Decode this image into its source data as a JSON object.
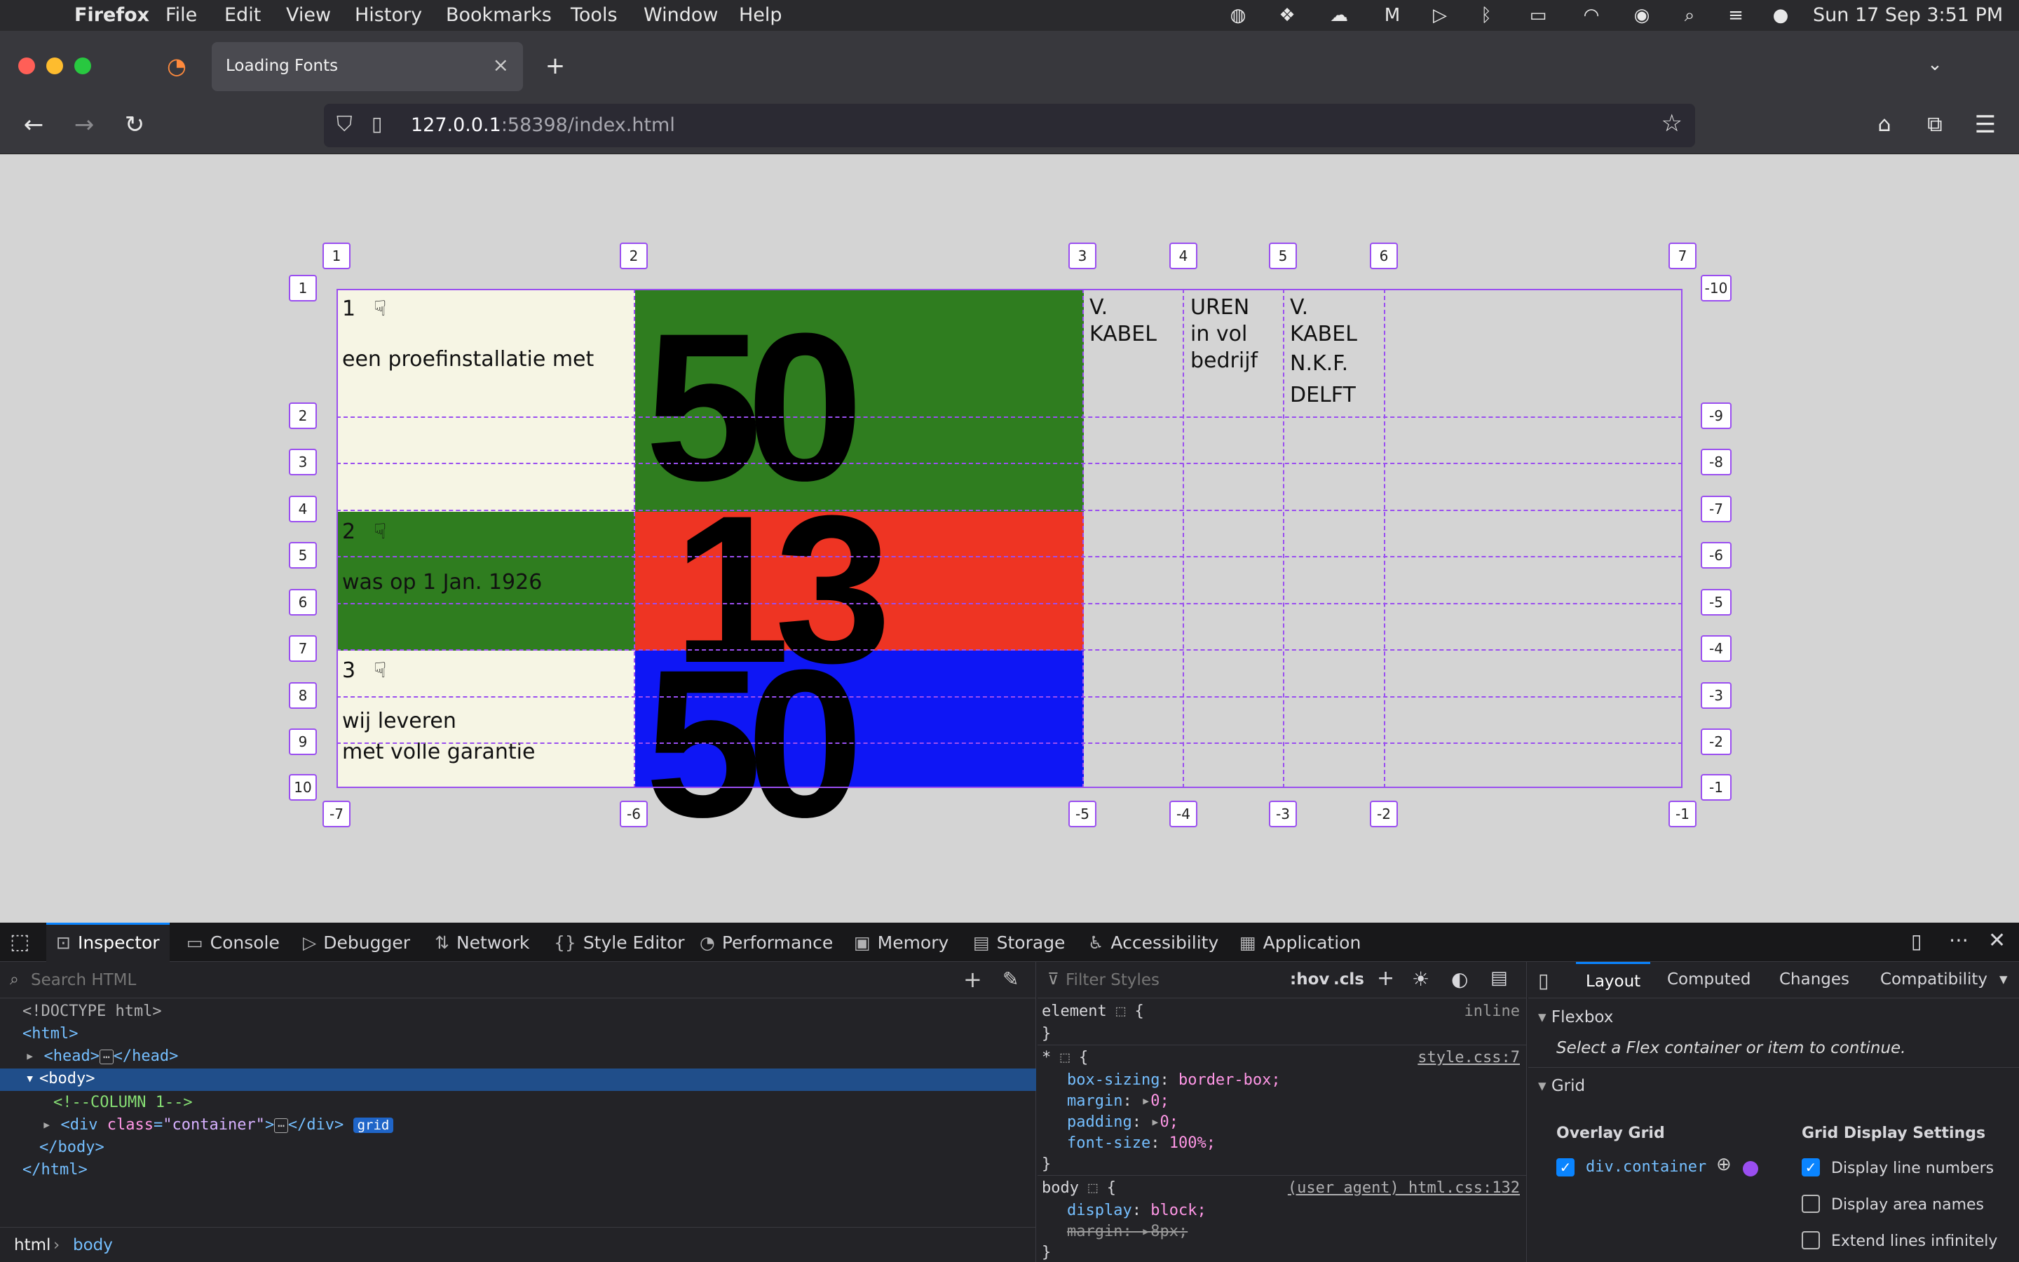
{
  "menubar": {
    "app": "Firefox",
    "items": [
      "File",
      "Edit",
      "View",
      "History",
      "Bookmarks",
      "Tools",
      "Window",
      "Help"
    ],
    "clock": "Sun 17 Sep  3:51 PM"
  },
  "browser": {
    "tab_title": "Loading Fonts",
    "url_host": "127.0.0.1",
    "url_rest": ":58398/index.html"
  },
  "page": {
    "cell1_num": "1",
    "cell1_text": "een proefinstallatie met",
    "cell2_num": "2",
    "cell2_text": "was op 1 Jan. 1926",
    "cell3_num": "3",
    "cell3_line1": "wij leveren",
    "cell3_line2": "met volle garantie",
    "pointer_glyph": "☟",
    "big1": "50",
    "big2": "13",
    "big3": "50",
    "col3_l1": "V.",
    "col3_l2": "KABEL",
    "col4_l1": "UREN",
    "col4_l2": "in vol",
    "col4_l3": "bedrijf",
    "col5_l1": "V.",
    "col5_l2": "KABEL",
    "col5_l3": "N.K.F.",
    "col5_l4": "DELFT",
    "colors": {
      "cream": "#f6f5e4",
      "green": "#2f7d1f",
      "red": "#ee3423",
      "blue": "#0e16f5",
      "overlay": "#9a4ef0"
    },
    "col_top_labels": [
      "1",
      "2",
      "3",
      "4",
      "5",
      "6",
      "7"
    ],
    "col_bottom_labels": [
      "-7",
      "-6",
      "-5",
      "-4",
      "-3",
      "-2",
      "-1"
    ],
    "row_left_labels": [
      "1",
      "2",
      "3",
      "4",
      "5",
      "6",
      "7",
      "8",
      "9",
      "10"
    ],
    "row_right_labels": [
      "-10",
      "-9",
      "-8",
      "-7",
      "-6",
      "-5",
      "-4",
      "-3",
      "-2",
      "-1"
    ]
  },
  "devtools": {
    "tabs": [
      "Inspector",
      "Console",
      "Debugger",
      "Network",
      "Style Editor",
      "Performance",
      "Memory",
      "Storage",
      "Accessibility",
      "Application"
    ],
    "search_placeholder": "Search HTML",
    "filter_placeholder": "Filter Styles",
    "hov": ":hov",
    "cls": ".cls",
    "html_lines": {
      "doctype": "<!DOCTYPE html>",
      "html_open": "<html>",
      "head": "<head>",
      "head_close": "</head>",
      "body_open": "<body>",
      "comment": "<!--COLUMN 1-->",
      "div_tag": "div",
      "div_attr": "class",
      "div_val": "\"container\"",
      "div_close": "</div>",
      "grid_badge": "grid",
      "body_close": "</body>",
      "html_close": "</html>"
    },
    "breadcrumb": [
      "html",
      "body"
    ],
    "rules": {
      "element_sel": "element",
      "element_src": "inline",
      "star_sel": "*",
      "star_src": "style.css:7",
      "decls": [
        {
          "p": "box-sizing",
          "v": "border-box;"
        },
        {
          "p": "margin",
          "v": "0;"
        },
        {
          "p": "padding",
          "v": "0;"
        },
        {
          "p": "font-size",
          "v": "100%;"
        }
      ],
      "body_sel": "body",
      "body_src": "(user agent) html.css:132",
      "body_decls": [
        {
          "p": "display",
          "v": "block;"
        },
        {
          "p": "margin",
          "v": "8px;"
        }
      ]
    },
    "layout_tabs": [
      "Layout",
      "Computed",
      "Changes",
      "Compatibility"
    ],
    "flexbox_title": "Flexbox",
    "flexbox_msg": "Select a Flex container or item to continue.",
    "grid_title": "Grid",
    "overlay_grid": "Overlay Grid",
    "overlay_item": "div.container",
    "settings_title": "Grid Display Settings",
    "settings": [
      {
        "label": "Display line numbers",
        "checked": true
      },
      {
        "label": "Display area names",
        "checked": false
      },
      {
        "label": "Extend lines infinitely",
        "checked": false
      }
    ]
  }
}
